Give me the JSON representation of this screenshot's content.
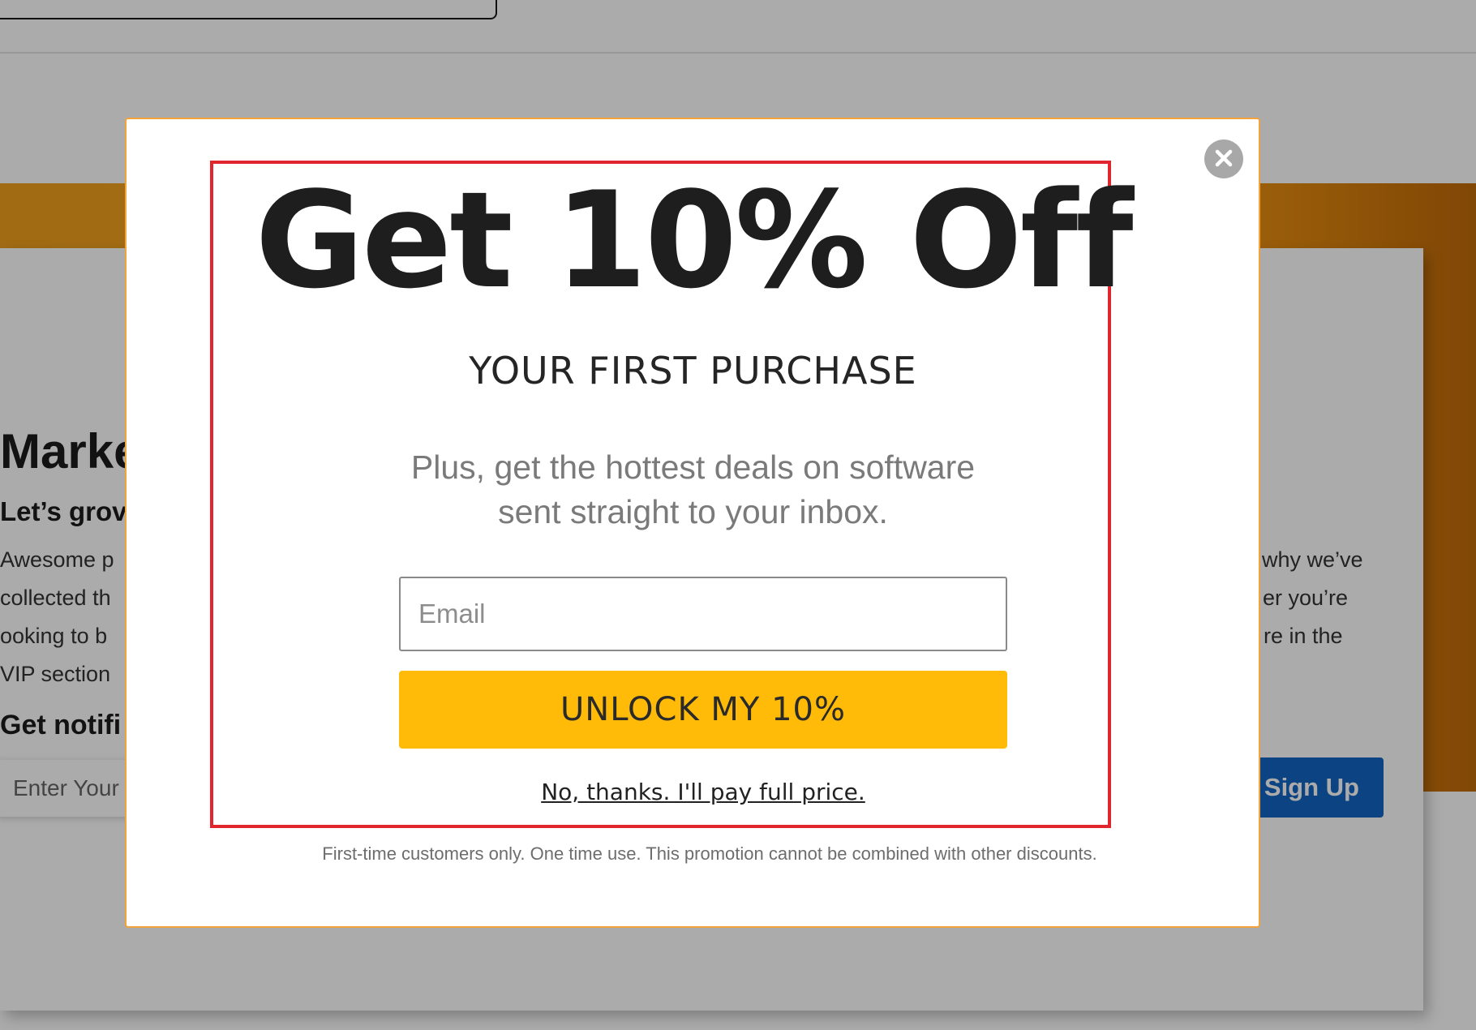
{
  "page": {
    "heading": "Marke",
    "subheading": "Let’s grov",
    "body_left": [
      "Awesome p",
      "collected th",
      "ooking to b",
      "VIP section"
    ],
    "body_right": [
      "why we’ve",
      "er you’re",
      "re in the"
    ],
    "notify": "Get notifi",
    "email_placeholder": "Enter Your",
    "signup_label": "Sign Up"
  },
  "modal": {
    "close_icon": "close-x",
    "headline": "Get 10% Off",
    "subheadline": "YOUR FIRST PURCHASE",
    "description_line1": "Plus, get the hottest deals on software",
    "description_line2": "sent straight to your inbox.",
    "email_placeholder": "Email",
    "unlock_label": "UNLOCK MY 10%",
    "decline_label": "No, thanks. I'll pay full price.",
    "disclaimer": "First-time customers only. One time use. This promotion cannot be combined with other discounts."
  },
  "colors": {
    "accent_orange": "#f7a21c",
    "unlock_yellow": "#ffbb08",
    "highlight_red": "#e1262e",
    "signup_blue": "#1266c4"
  }
}
